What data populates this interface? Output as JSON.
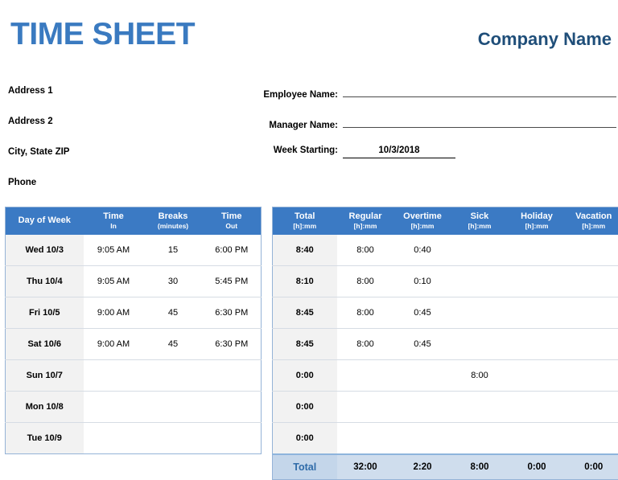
{
  "header": {
    "title": "TIME SHEET",
    "company_name": "Company Name",
    "title_color": "#3a7ac0",
    "company_color": "#1f4e79"
  },
  "address": {
    "lines": [
      "Address 1",
      "Address 2",
      "City, State  ZIP",
      "Phone"
    ]
  },
  "form": {
    "employee_name": {
      "label": "Employee Name:",
      "value": ""
    },
    "manager_name": {
      "label": "Manager Name:",
      "value": ""
    },
    "week_starting": {
      "label": "Week Starting:",
      "value": "10/3/2018"
    }
  },
  "left_table": {
    "headers": [
      {
        "main": "Day of Week",
        "sub": ""
      },
      {
        "main": "Time",
        "sub": "In"
      },
      {
        "main": "Breaks",
        "sub": "(minutes)"
      },
      {
        "main": "Time",
        "sub": "Out"
      }
    ],
    "rows": [
      {
        "day": "Wed 10/3",
        "time_in": "9:05 AM",
        "breaks": "15",
        "time_out": "6:00 PM"
      },
      {
        "day": "Thu 10/4",
        "time_in": "9:05 AM",
        "breaks": "30",
        "time_out": "5:45 PM"
      },
      {
        "day": "Fri 10/5",
        "time_in": "9:00 AM",
        "breaks": "45",
        "time_out": "6:30 PM"
      },
      {
        "day": "Sat 10/6",
        "time_in": "9:00 AM",
        "breaks": "45",
        "time_out": "6:30 PM"
      },
      {
        "day": "Sun 10/7",
        "time_in": "",
        "breaks": "",
        "time_out": ""
      },
      {
        "day": "Mon 10/8",
        "time_in": "",
        "breaks": "",
        "time_out": ""
      },
      {
        "day": "Tue 10/9",
        "time_in": "",
        "breaks": "",
        "time_out": ""
      }
    ]
  },
  "right_table": {
    "headers": [
      {
        "main": "Total",
        "sub": "[h]:mm"
      },
      {
        "main": "Regular",
        "sub": "[h]:mm"
      },
      {
        "main": "Overtime",
        "sub": "[h]:mm"
      },
      {
        "main": "Sick",
        "sub": "[h]:mm"
      },
      {
        "main": "Holiday",
        "sub": "[h]:mm"
      },
      {
        "main": "Vacation",
        "sub": "[h]:mm"
      }
    ],
    "rows": [
      {
        "total": "8:40",
        "regular": "8:00",
        "overtime": "0:40",
        "sick": "",
        "holiday": "",
        "vacation": ""
      },
      {
        "total": "8:10",
        "regular": "8:00",
        "overtime": "0:10",
        "sick": "",
        "holiday": "",
        "vacation": ""
      },
      {
        "total": "8:45",
        "regular": "8:00",
        "overtime": "0:45",
        "sick": "",
        "holiday": "",
        "vacation": ""
      },
      {
        "total": "8:45",
        "regular": "8:00",
        "overtime": "0:45",
        "sick": "",
        "holiday": "",
        "vacation": ""
      },
      {
        "total": "0:00",
        "regular": "",
        "overtime": "",
        "sick": "8:00",
        "holiday": "",
        "vacation": ""
      },
      {
        "total": "0:00",
        "regular": "",
        "overtime": "",
        "sick": "",
        "holiday": "",
        "vacation": ""
      },
      {
        "total": "0:00",
        "regular": "",
        "overtime": "",
        "sick": "",
        "holiday": "",
        "vacation": ""
      }
    ],
    "total_row": {
      "label": "Total",
      "regular": "32:00",
      "overtime": "2:20",
      "sick": "8:00",
      "holiday": "0:00",
      "vacation": "0:00"
    }
  },
  "colors": {
    "header_blue": "#3b7ac4",
    "total_row_blue": "#cfdded",
    "key_col_gray": "#f2f2f2",
    "table_border": "#95b3d7"
  }
}
